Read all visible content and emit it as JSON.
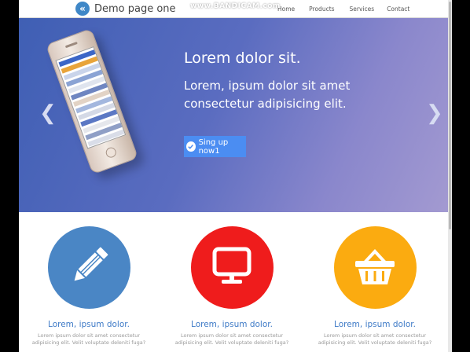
{
  "brand": {
    "name": "Demo page one",
    "logo_glyph": "«"
  },
  "nav": {
    "items": [
      {
        "label": "Home"
      },
      {
        "label": "Products"
      },
      {
        "label": "Services"
      },
      {
        "label": "Contact"
      }
    ]
  },
  "watermark": {
    "text": "www.BANDICAM.com"
  },
  "hero": {
    "title": "Lorem dolor sit.",
    "subtitle": "Lorem, ipsum dolor sit amet consectetur adipisicing elit.",
    "cta_label": "Sing up now1",
    "prev_glyph": "❮",
    "next_glyph": "❯"
  },
  "features": [
    {
      "title": "Lorem, ipsum dolor.",
      "text": "Lorem ipsum dolor sit amet consectetur adipisicing elit. Velit voluptate deleniti fuga?",
      "color": "#4a86c5",
      "icon": "pencil-icon"
    },
    {
      "title": "Lorem, ipsum dolor.",
      "text": "Lorem ipsum dolor sit amet consectetur adipisicing elit. Velit voluptate deleniti fuga?",
      "color": "#ef1c1c",
      "icon": "monitor-icon"
    },
    {
      "title": "Lorem, ipsum dolor.",
      "text": "Lorem ipsum dolor sit amet consectetur adipisicing elit. Velit voluptate deleniti fuga?",
      "color": "#fbab10",
      "icon": "basket-icon"
    }
  ],
  "colors": {
    "accent": "#3f7bc7",
    "cta": "#4b8df2",
    "hero_start": "#3f5fb4",
    "hero_end": "#a39ad1"
  }
}
